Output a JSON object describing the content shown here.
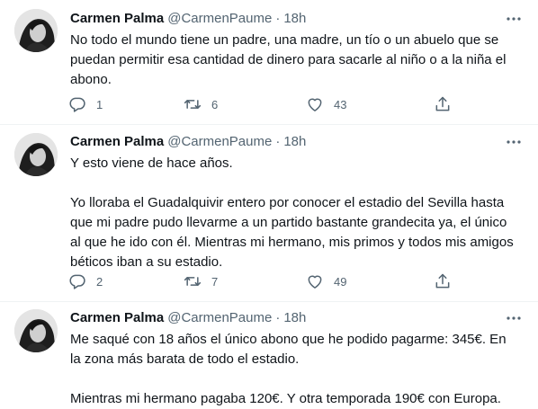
{
  "tweets": [
    {
      "name": "Carmen Palma",
      "handle": "@CarmenPaume",
      "separator": "·",
      "time": "18h",
      "paragraphs": [
        "No todo el mundo tiene un padre, una madre, un tío o un abuelo que se puedan permitir esa cantidad de dinero para sacarle al niño o a la niña el abono."
      ],
      "replies": "1",
      "retweets": "6",
      "likes": "43"
    },
    {
      "name": "Carmen Palma",
      "handle": "@CarmenPaume",
      "separator": "·",
      "time": "18h",
      "paragraphs": [
        "Y esto viene de hace años.",
        "Yo lloraba el Guadalquivir entero por conocer el estadio del Sevilla hasta que mi padre pudo llevarme a un partido bastante grandecita ya, el único al que he ido con él. Mientras mi hermano, mis primos y todos mis amigos béticos iban a su estadio."
      ],
      "replies": "2",
      "retweets": "7",
      "likes": "49"
    },
    {
      "name": "Carmen Palma",
      "handle": "@CarmenPaume",
      "separator": "·",
      "time": "18h",
      "paragraphs": [
        "Me saqué con 18 años el único abono que he podido pagarme: 345€. En la zona más barata de todo el estadio.",
        "Mientras mi hermano pagaba 120€. Y otra temporada 190€ con Europa."
      ]
    }
  ],
  "icons": {
    "more": "more-horizontal-icon",
    "reply": "reply-icon",
    "retweet": "retweet-icon",
    "like": "heart-icon",
    "share": "share-icon"
  },
  "colors": {
    "text": "#0f1419",
    "secondary": "#536471",
    "divider": "#eff3f4"
  }
}
